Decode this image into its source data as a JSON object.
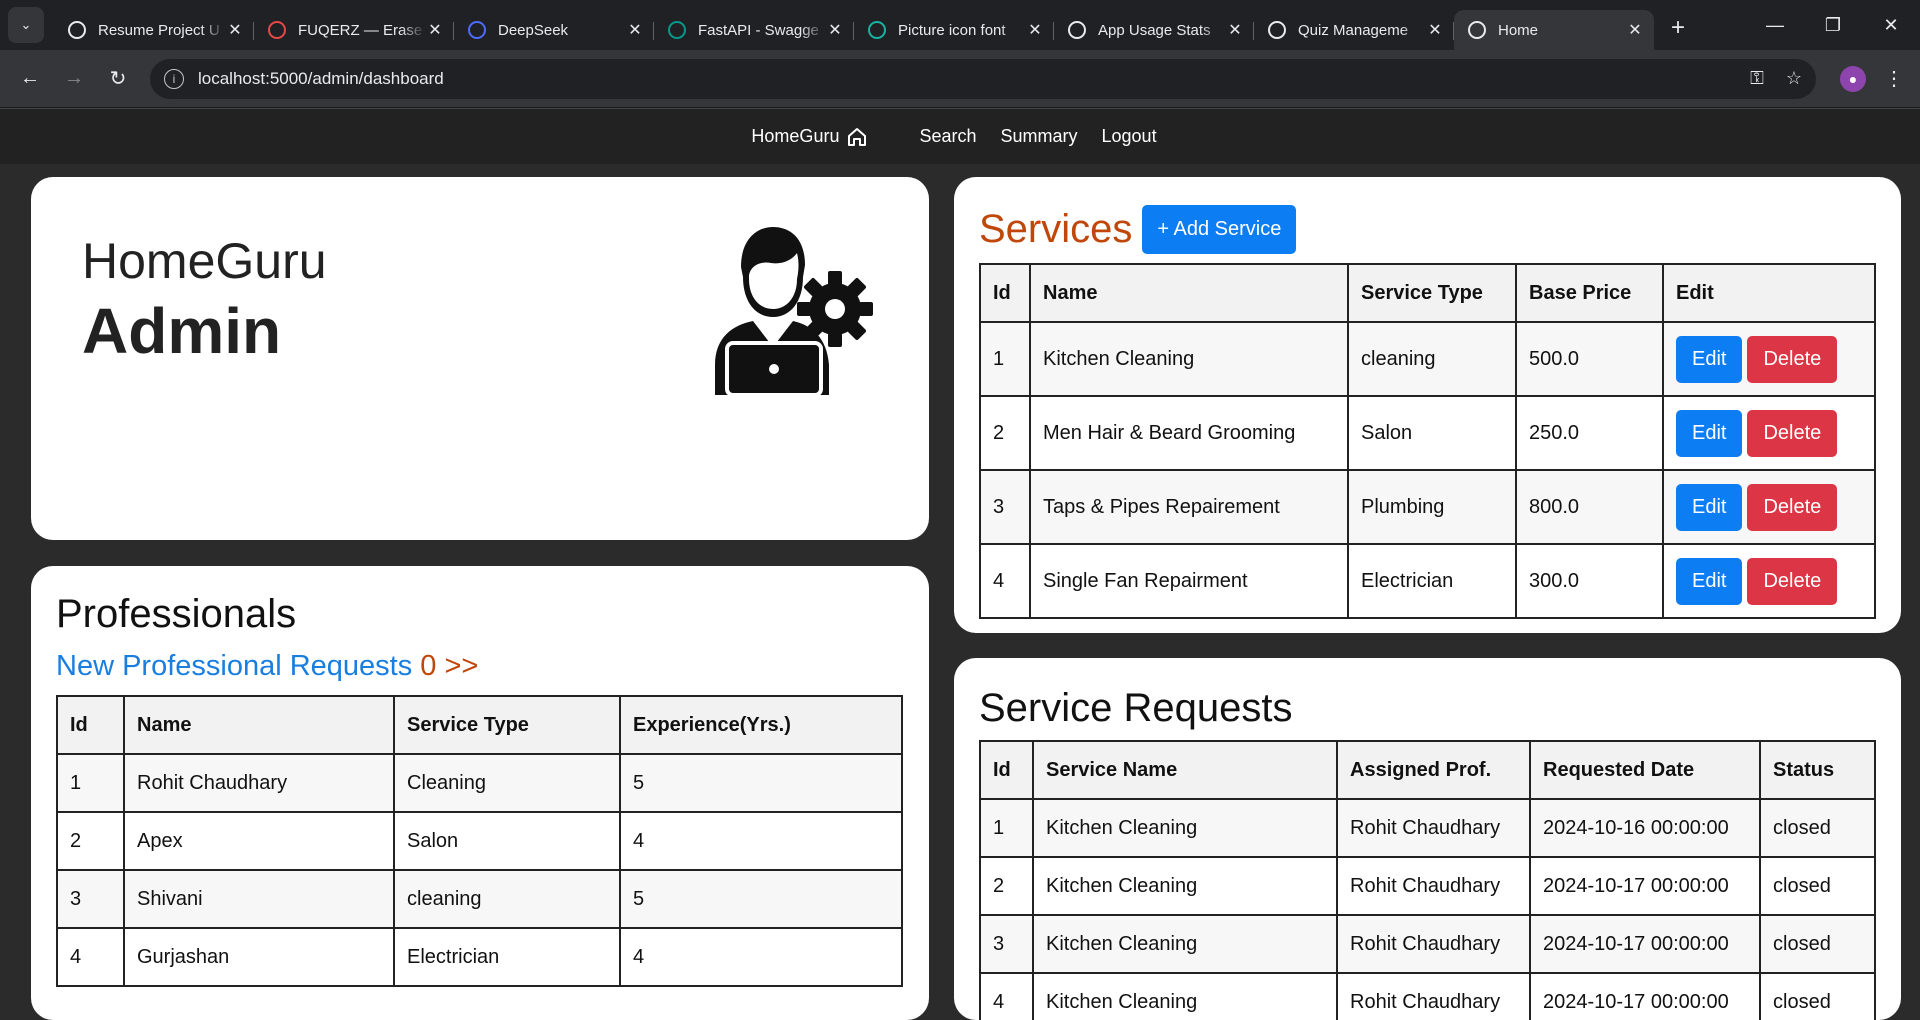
{
  "browser": {
    "tabs": [
      {
        "title": "Resume Project U",
        "icon": "openai-icon",
        "color": "#e8eaed"
      },
      {
        "title": "FUQERZ — Erase",
        "icon": "eraser-logo-icon",
        "color": "#e64848"
      },
      {
        "title": "DeepSeek",
        "icon": "deepseek-whale-icon",
        "color": "#4d6bfe"
      },
      {
        "title": "FastAPI - Swagge",
        "icon": "fastapi-icon",
        "color": "#05998b"
      },
      {
        "title": "Picture icon font",
        "icon": "vite-icon",
        "color": "#17b3a3"
      },
      {
        "title": "App Usage Stats",
        "icon": "globe-icon",
        "color": "#e8eaed"
      },
      {
        "title": "Quiz Manageme",
        "icon": "globe-icon",
        "color": "#e8eaed"
      },
      {
        "title": "Home",
        "icon": "home-icon",
        "color": "#e8eaed"
      }
    ],
    "url": "localhost:5000/admin/dashboard"
  },
  "nav": {
    "brand": "HomeGuru",
    "links": [
      "Search",
      "Summary",
      "Logout"
    ]
  },
  "hero": {
    "title": "HomeGuru",
    "subtitle": "Admin"
  },
  "professionals": {
    "heading": "Professionals",
    "requests_label": "New Professional Requests",
    "requests_count": "0 >>",
    "columns": [
      "Id",
      "Name",
      "Service Type",
      "Experience(Yrs.)"
    ],
    "rows": [
      [
        "1",
        "Rohit Chaudhary",
        "Cleaning",
        "5"
      ],
      [
        "2",
        "Apex",
        "Salon",
        "4"
      ],
      [
        "3",
        "Shivani",
        "cleaning",
        "5"
      ],
      [
        "4",
        "Gurjashan",
        "Electrician",
        "4"
      ]
    ]
  },
  "services": {
    "heading": "Services",
    "add_label": "+ Add Service",
    "columns": [
      "Id",
      "Name",
      "Service Type",
      "Base Price",
      "Edit"
    ],
    "edit_label": "Edit",
    "delete_label": "Delete",
    "rows": [
      [
        "1",
        "Kitchen Cleaning",
        "cleaning",
        "500.0"
      ],
      [
        "2",
        "Men Hair & Beard Grooming",
        "Salon",
        "250.0"
      ],
      [
        "3",
        "Taps & Pipes Repairement",
        "Plumbing",
        "800.0"
      ],
      [
        "4",
        "Single Fan Repairment",
        "Electrician",
        "300.0"
      ]
    ]
  },
  "service_requests": {
    "heading": "Service Requests",
    "columns": [
      "Id",
      "Service Name",
      "Assigned Prof.",
      "Requested Date",
      "Status"
    ],
    "rows": [
      [
        "1",
        "Kitchen Cleaning",
        "Rohit Chaudhary",
        "2024-10-16 00:00:00",
        "closed"
      ],
      [
        "2",
        "Kitchen Cleaning",
        "Rohit Chaudhary",
        "2024-10-17 00:00:00",
        "closed"
      ],
      [
        "3",
        "Kitchen Cleaning",
        "Rohit Chaudhary",
        "2024-10-17 00:00:00",
        "closed"
      ],
      [
        "4",
        "Kitchen Cleaning",
        "Rohit Chaudhary",
        "2024-10-17 00:00:00",
        "closed"
      ]
    ]
  }
}
